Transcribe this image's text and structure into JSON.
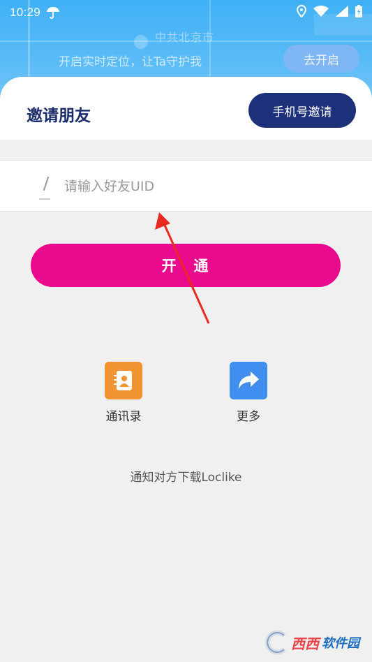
{
  "status_bar": {
    "time": "10:29"
  },
  "map": {
    "place_name": "中共北京市",
    "locate_prompt": "开启实时定位，让Ta守护我",
    "locate_button": "去开启"
  },
  "header": {
    "title": "邀请朋友",
    "phone_invite_button": "手机号邀请"
  },
  "uid_input": {
    "placeholder": "请输入好友UID",
    "value": ""
  },
  "open_button": "开　通",
  "share_options": [
    {
      "label": "通讯录",
      "icon": "contacts-icon",
      "color": "#f39433"
    },
    {
      "label": "更多",
      "icon": "share-arrow-icon",
      "color": "#3f8ef0"
    }
  ],
  "notify_text": "通知对方下载Loclike",
  "watermark": {
    "main": "西西",
    "sub": "软件园"
  },
  "colors": {
    "accent_pink": "#ea0a8e",
    "navy": "#1c3179",
    "map_blue": "#3fb0f5",
    "annotation_red": "#ea2a20"
  }
}
